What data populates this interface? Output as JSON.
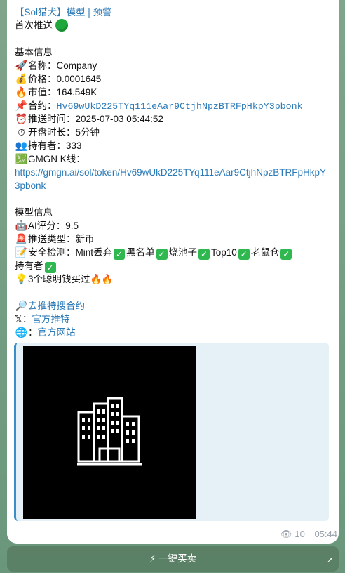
{
  "message": {
    "header_lines": [
      "【Sol猎犬】模型 | 预警",
      "首次推送"
    ],
    "basic_title": "基本信息",
    "name_label": "名称：",
    "name_value": "Company",
    "price_label": "价格：",
    "price_value": "0.0001645",
    "mcap_label": "市值：",
    "mcap_value": "164.549K",
    "contract_label": "合约：",
    "contract_value": "Hv69wUkD225TYq111eAar9CtjhNpzBTRFpHkpY3pbonk",
    "push_time_label": "推送时间：",
    "push_time_value": "2025-07-03 05:44:52",
    "open_dur_label": "开盘时长：",
    "open_dur_value": "5分钟",
    "holders_label": "持有者：",
    "holders_value": "333",
    "gmgn_label": "GMGN K线：",
    "gmgn_url": "https://gmgn.ai/sol/token/Hv69wUkD225TYq111eAar9CtjhNpzBTRFpHkpY3pbonk",
    "model_title": "模型信息",
    "ai_label": "AI评分：",
    "ai_value": "9.5",
    "type_label": "推送类型：",
    "type_value": "新币",
    "safety_label": "安全检测：",
    "safety_items": [
      "Mint丢弃",
      "黑名单",
      "烧池子",
      "Top10",
      "老鼠仓"
    ],
    "safety_last": "持有者",
    "smart_money": "3个聪明钱买过",
    "twitter_search": "去推特搜合约",
    "x_label": "𝕏：",
    "x_link": "官方推特",
    "web_label": "：",
    "web_link": "官方网站"
  },
  "footer": {
    "views": "10",
    "time": "05:44"
  },
  "action_button": {
    "label": "⚡ 一键买卖"
  },
  "colors": {
    "link": "#2a7ab8",
    "check": "#2fb84f",
    "accent_bar": "#3a8fc9"
  },
  "icons": [
    "rocket-icon",
    "money-bag-icon",
    "fire-icon",
    "pushpin-icon",
    "alarm-clock-icon",
    "stopwatch-icon",
    "people-icon",
    "chart-icon",
    "robot-icon",
    "siren-icon",
    "memo-icon",
    "bulb-icon",
    "magnifier-icon",
    "globe-icon",
    "eye-icon",
    "building-icon"
  ]
}
